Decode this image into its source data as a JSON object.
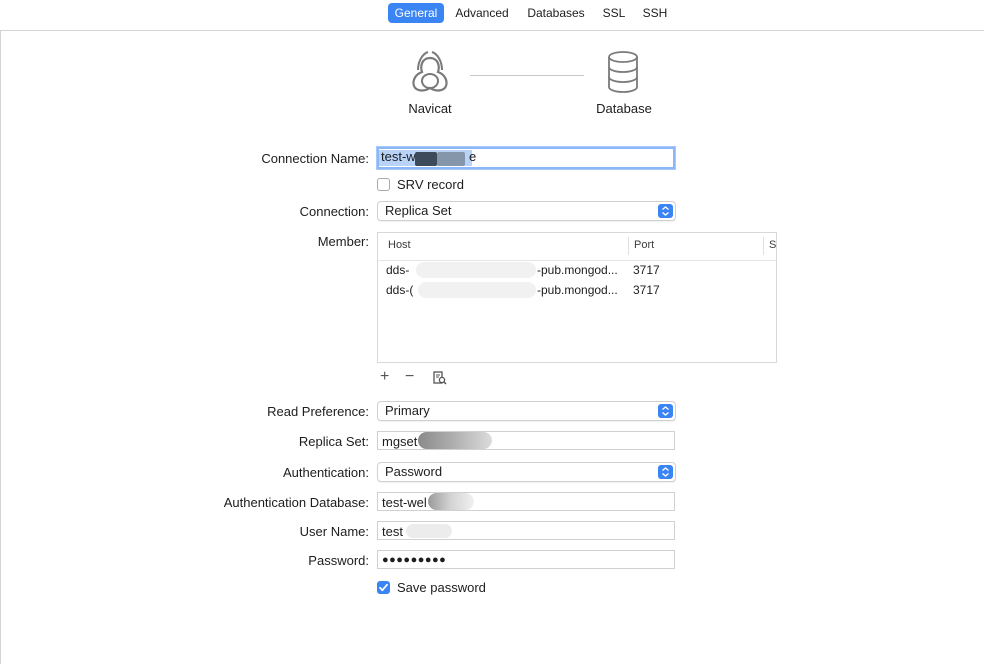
{
  "tabs": [
    {
      "label": "General",
      "active": true
    },
    {
      "label": "Advanced",
      "active": false
    },
    {
      "label": "Databases",
      "active": false
    },
    {
      "label": "SSL",
      "active": false
    },
    {
      "label": "SSH",
      "active": false
    }
  ],
  "diagram": {
    "left_label": "Navicat",
    "right_label": "Database"
  },
  "form": {
    "connection_name": {
      "label": "Connection Name:",
      "value": "test-w",
      "value_tail": "e"
    },
    "srv_record": {
      "label": "SRV record",
      "checked": false
    },
    "connection": {
      "label": "Connection:",
      "value": "Replica Set"
    },
    "member": {
      "label": "Member:",
      "columns": [
        "Host",
        "Port",
        "S"
      ],
      "rows": [
        {
          "host_start": "dds-",
          "host_end": "-pub.mongod...",
          "port": "3717"
        },
        {
          "host_start": "dds-(",
          "host_end": "-pub.mongod...",
          "port": "3717"
        }
      ],
      "tools": {
        "add": "+",
        "remove": "−"
      }
    },
    "read_preference": {
      "label": "Read Preference:",
      "value": "Primary"
    },
    "replica_set": {
      "label": "Replica Set:",
      "value": "mgset"
    },
    "authentication": {
      "label": "Authentication:",
      "value": "Password"
    },
    "auth_database": {
      "label": "Authentication Database:",
      "value": "test-wel"
    },
    "user_name": {
      "label": "User Name:",
      "value": "test"
    },
    "password": {
      "label": "Password:",
      "value": "●●●●●●●●●"
    },
    "save_password": {
      "label": "Save password",
      "checked": true
    }
  },
  "colors": {
    "accent": "#3a84f3",
    "focus_ring": "#8bb6f7"
  }
}
